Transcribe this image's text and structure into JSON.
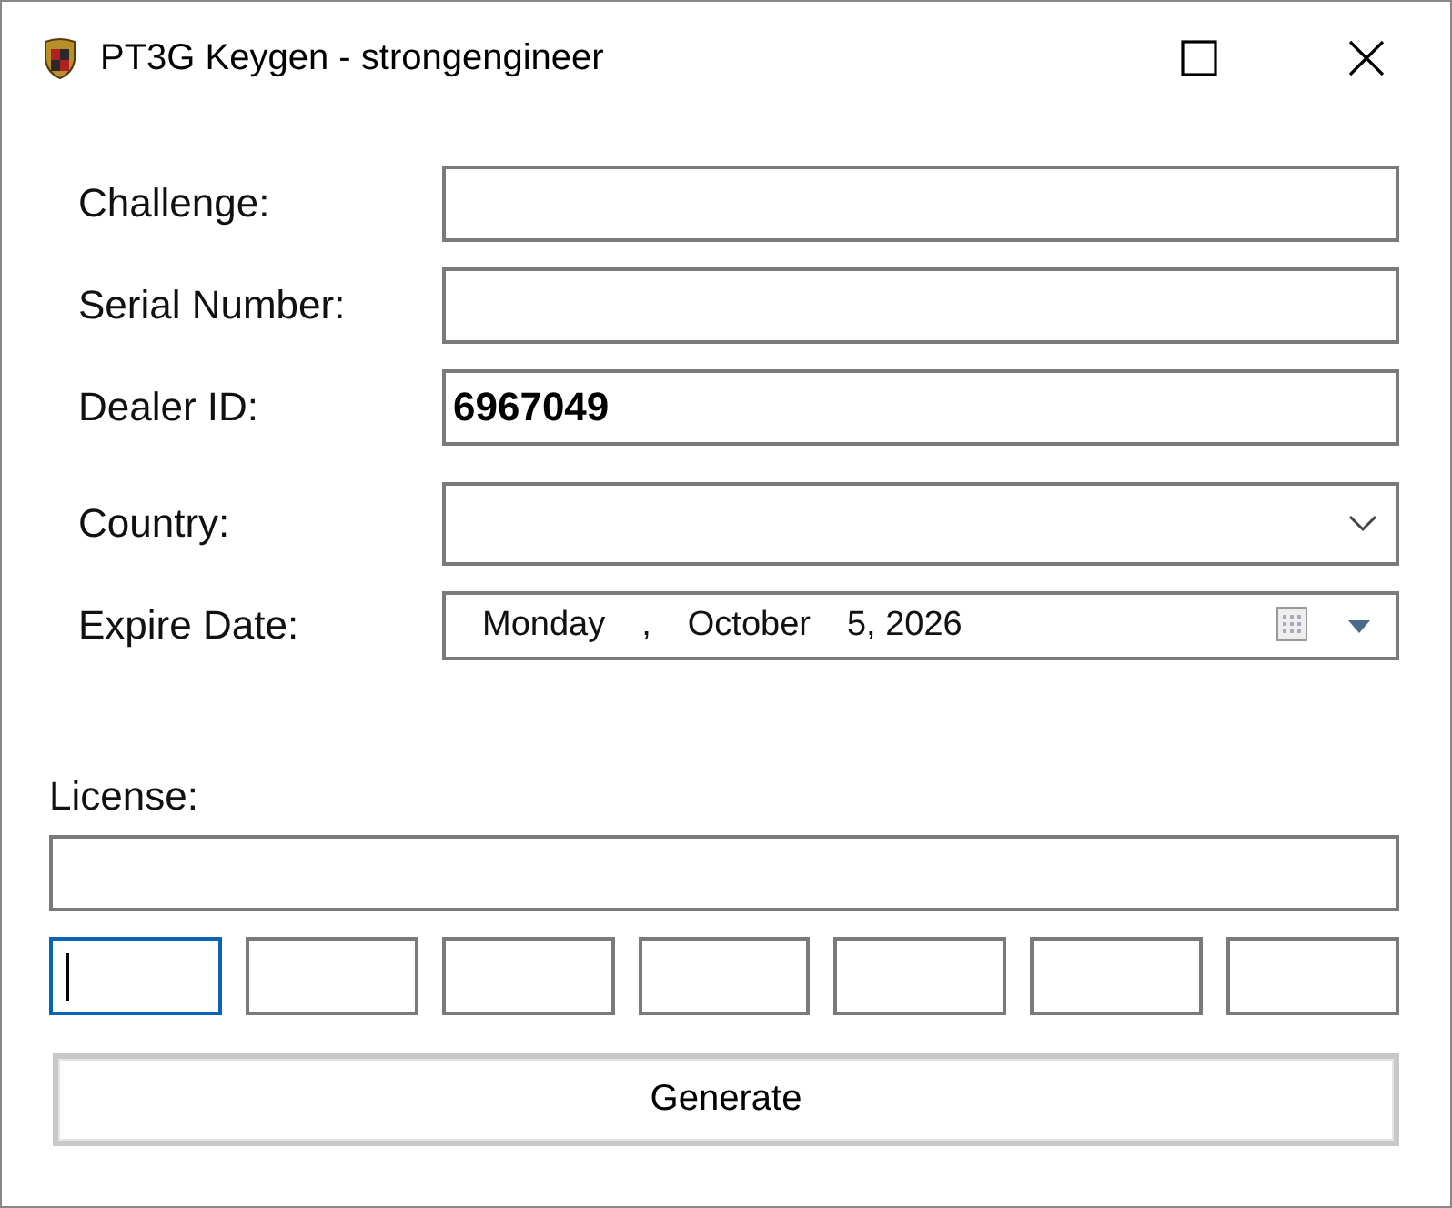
{
  "window": {
    "title": "PT3G Keygen - strongengineer"
  },
  "fields": [
    {
      "kind": "text",
      "label": "Challenge:"
    },
    {
      "kind": "text",
      "label": "Serial Number:"
    },
    {
      "kind": "text",
      "label": "Dealer ID:",
      "value": "6967049"
    },
    {
      "kind": "combo",
      "label": "Country:"
    },
    {
      "kind": "date",
      "label": "Expire Date:",
      "parts": [
        "Monday",
        ",",
        "October",
        "5, 2026"
      ]
    }
  ],
  "license": {
    "label": "License:",
    "boxes": [
      {
        "focused": true
      },
      {
        "focused": false
      },
      {
        "focused": false
      },
      {
        "focused": false
      },
      {
        "focused": false
      },
      {
        "focused": false
      },
      {
        "focused": false
      }
    ]
  },
  "buttons": [
    "Generate"
  ]
}
